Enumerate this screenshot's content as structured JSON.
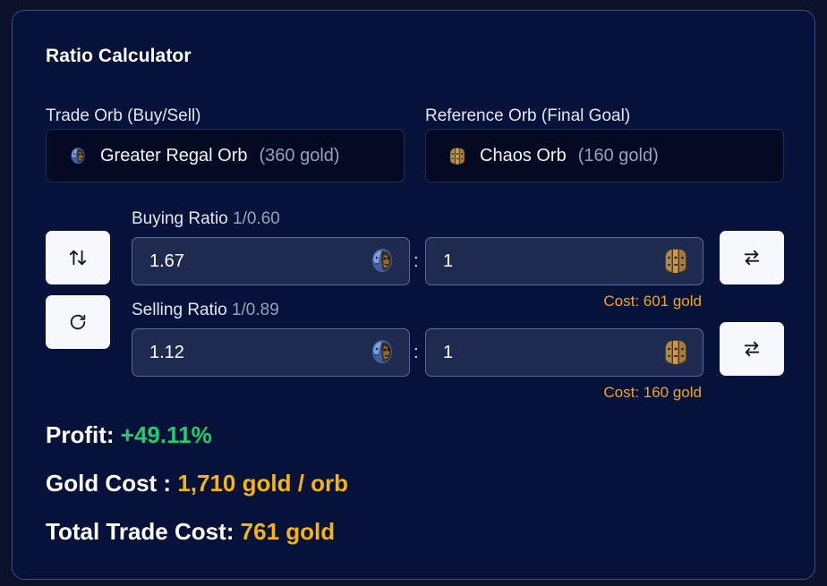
{
  "title": "Ratio Calculator",
  "trade_orb": {
    "label": "Trade Orb (Buy/Sell)",
    "name": "Greater Regal Orb",
    "gold": "(360 gold)",
    "icon": "greater-regal-orb-icon"
  },
  "reference_orb": {
    "label": "Reference Orb (Final Goal)",
    "name": "Chaos Orb",
    "gold": "(160 gold)",
    "icon": "chaos-orb-icon"
  },
  "buying": {
    "label": "Buying Ratio",
    "sub": "1/0.60",
    "left_value": "1.67",
    "colon": ":",
    "right_value": "1",
    "cost": "Cost: 601 gold"
  },
  "selling": {
    "label": "Selling Ratio",
    "sub": "1/0.89",
    "left_value": "1.12",
    "colon": ":",
    "right_value": "1",
    "cost": "Cost: 160 gold"
  },
  "summary": {
    "profit_label": "Profit:",
    "profit_value": "+49.11%",
    "gold_cost_label": "Gold Cost :",
    "gold_cost_value": "1,710 gold / orb",
    "total_label": "Total Trade Cost:",
    "total_value": "761 gold"
  },
  "colors": {
    "background": "#06123a",
    "profit": "#1dd16a",
    "gold": "#f6b40e",
    "cost": "#f2a51a"
  }
}
